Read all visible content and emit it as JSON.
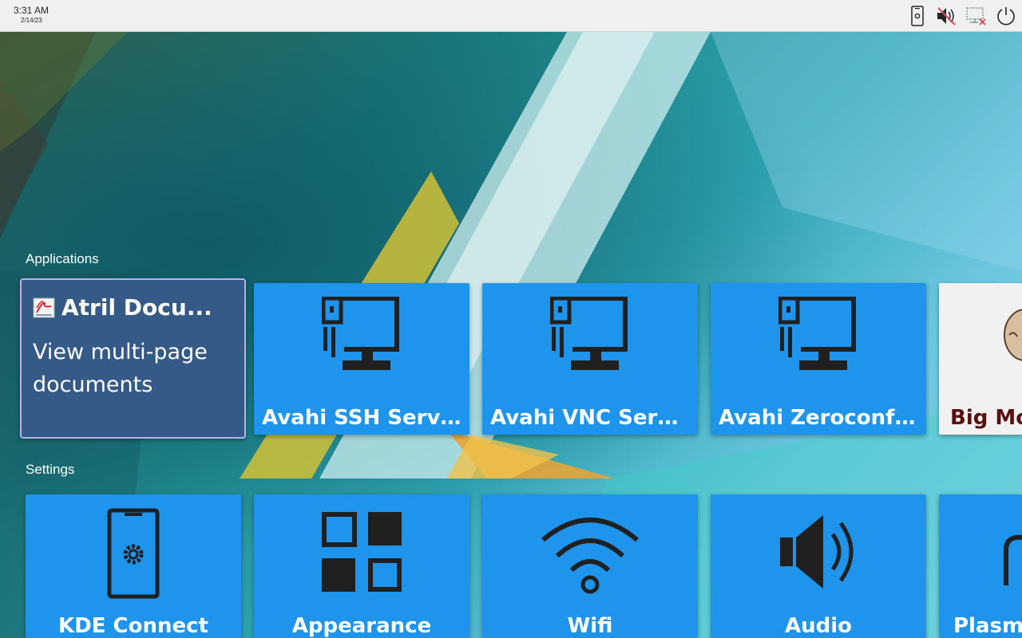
{
  "topbar": {
    "time": "3:31 AM",
    "date": "2/14/23",
    "tray": {
      "device": "phone-settings-icon",
      "volume": "volume-muted-icon",
      "network": "network-disconnected-icon",
      "power": "power-icon"
    }
  },
  "applications": {
    "title": "Applications",
    "selected": {
      "name": "Atril Docu...",
      "description": "View multi-page documents",
      "icon": "atril-document-icon"
    },
    "items": [
      {
        "label": "Avahi SSH Server...",
        "icon": "network-computer-icon"
      },
      {
        "label": "Avahi VNC Serve...",
        "icon": "network-computer-icon"
      },
      {
        "label": "Avahi Zeroconf ...",
        "icon": "network-computer-icon"
      },
      {
        "label": "Big Mo",
        "icon": "big-mouth-icon"
      }
    ]
  },
  "settings": {
    "title": "Settings",
    "items": [
      {
        "label": "KDE Connect",
        "icon": "phone-gear-icon"
      },
      {
        "label": "Appearance",
        "icon": "grid-squares-icon"
      },
      {
        "label": "Wifi",
        "icon": "wifi-icon"
      },
      {
        "label": "Audio",
        "icon": "speaker-icon"
      },
      {
        "label": "Plasma",
        "icon": "plasma-icon"
      }
    ]
  },
  "colors": {
    "tile": "#1f94ec",
    "tile_selected": "#355a88",
    "selection_border": "#b7b3f0",
    "topbar": "#eff0f1"
  }
}
